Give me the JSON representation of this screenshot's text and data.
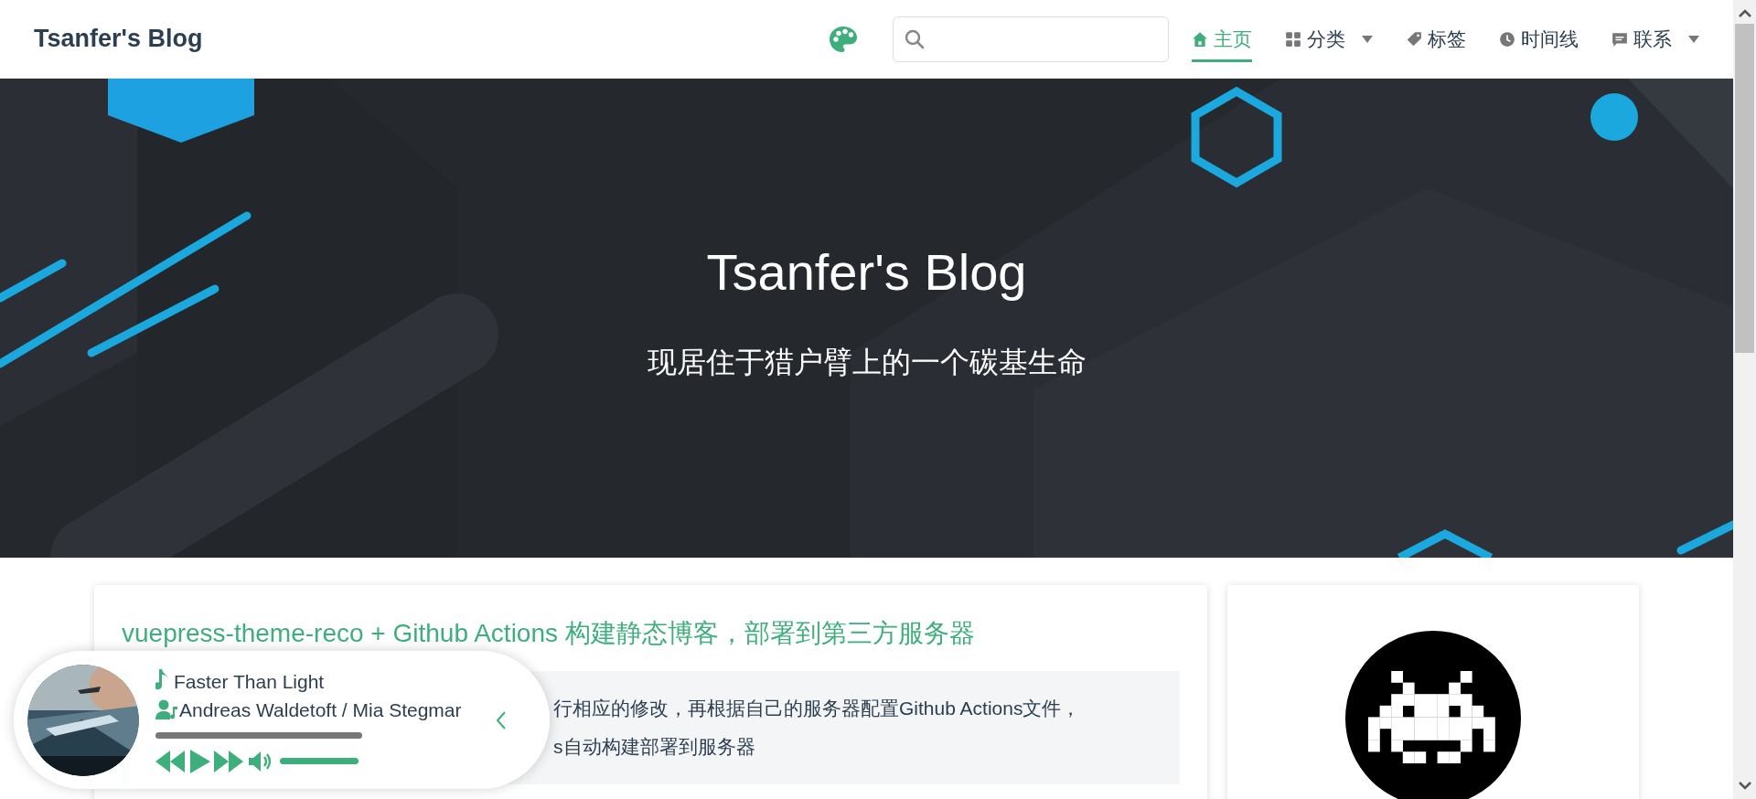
{
  "navbar": {
    "site_title": "Tsanfer's Blog",
    "items": [
      {
        "label": "主页",
        "kind": "home",
        "selected": true,
        "dropdown": false
      },
      {
        "label": "分类",
        "kind": "grid",
        "selected": false,
        "dropdown": true
      },
      {
        "label": "标签",
        "kind": "tag",
        "selected": false,
        "dropdown": false
      },
      {
        "label": "时间线",
        "kind": "clock",
        "selected": false,
        "dropdown": false
      },
      {
        "label": "联系",
        "kind": "chat",
        "selected": false,
        "dropdown": true
      }
    ]
  },
  "hero": {
    "title": "Tsanfer's Blog",
    "subtitle": "现居住于猎户臂上的一个碳基生命"
  },
  "post": {
    "title": "vuepress-theme-reco + Github Actions 构建静态博客，部署到第三方服务器",
    "quote": [
      "行相应的修改，再根据自己的服务器配置Github Actions文件，",
      "s自动构建部署到服务器"
    ]
  },
  "player": {
    "song": "Faster Than Light",
    "artist": "Andreas Waldetoft / Mia Stegmar"
  }
}
